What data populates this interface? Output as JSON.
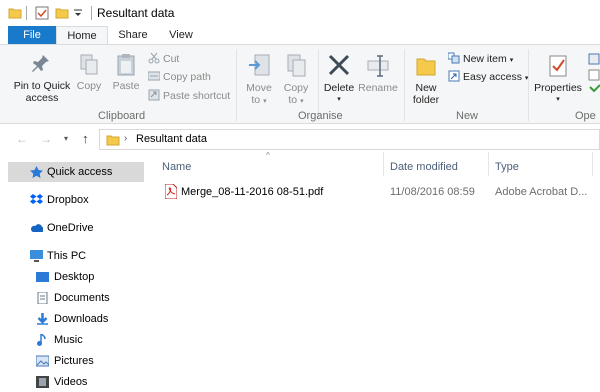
{
  "window": {
    "title": "Resultant data"
  },
  "tabs": {
    "file": "File",
    "home": "Home",
    "share": "Share",
    "view": "View"
  },
  "ribbon": {
    "clipboard": {
      "label": "Clipboard",
      "pin_line1": "Pin to Quick",
      "pin_line2": "access",
      "copy": "Copy",
      "paste": "Paste",
      "cut": "Cut",
      "copy_path": "Copy path",
      "paste_shortcut": "Paste shortcut"
    },
    "organise": {
      "label": "Organise",
      "move_to": "Move",
      "move_to_2": "to",
      "copy_to": "Copy",
      "copy_to_2": "to",
      "delete": "Delete",
      "rename": "Rename"
    },
    "new": {
      "label": "New",
      "new_folder_1": "New",
      "new_folder_2": "folder",
      "new_item": "New item",
      "easy_access": "Easy access"
    },
    "open": {
      "label": "Ope",
      "properties": "Properties"
    }
  },
  "address": {
    "crumb": "Resultant data"
  },
  "nav": {
    "quick_access": "Quick access",
    "dropbox": "Dropbox",
    "onedrive": "OneDrive",
    "this_pc": "This PC",
    "desktop": "Desktop",
    "documents": "Documents",
    "downloads": "Downloads",
    "music": "Music",
    "pictures": "Pictures",
    "videos": "Videos"
  },
  "columns": {
    "name": "Name",
    "date": "Date modified",
    "type": "Type"
  },
  "files": [
    {
      "name": "Merge_08-11-2016 08-51.pdf",
      "date": "11/08/2016 08:59",
      "type": "Adobe Acrobat D..."
    }
  ],
  "colors": {
    "file_tab": "#1979ca",
    "selected_nav": "#d9d9d9",
    "header_text": "#4c607a"
  }
}
